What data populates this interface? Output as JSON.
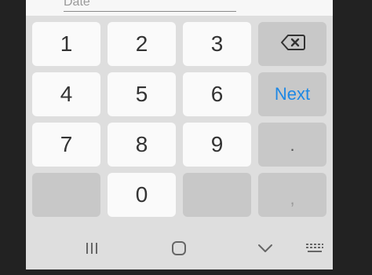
{
  "field": {
    "hint": "Date"
  },
  "keys": {
    "k1": "1",
    "k2": "2",
    "k3": "3",
    "k4": "4",
    "k5": "5",
    "k6": "6",
    "k7": "7",
    "k8": "8",
    "k9": "9",
    "k0": "0",
    "next": "Next",
    "period": ".",
    "comma": ","
  },
  "icons": {
    "backspace": "backspace-icon",
    "recents": "recents-icon",
    "home": "home-icon",
    "back": "back-chevron-icon",
    "keyboard": "keyboard-icon"
  },
  "colors": {
    "accent": "#1e88e5"
  }
}
